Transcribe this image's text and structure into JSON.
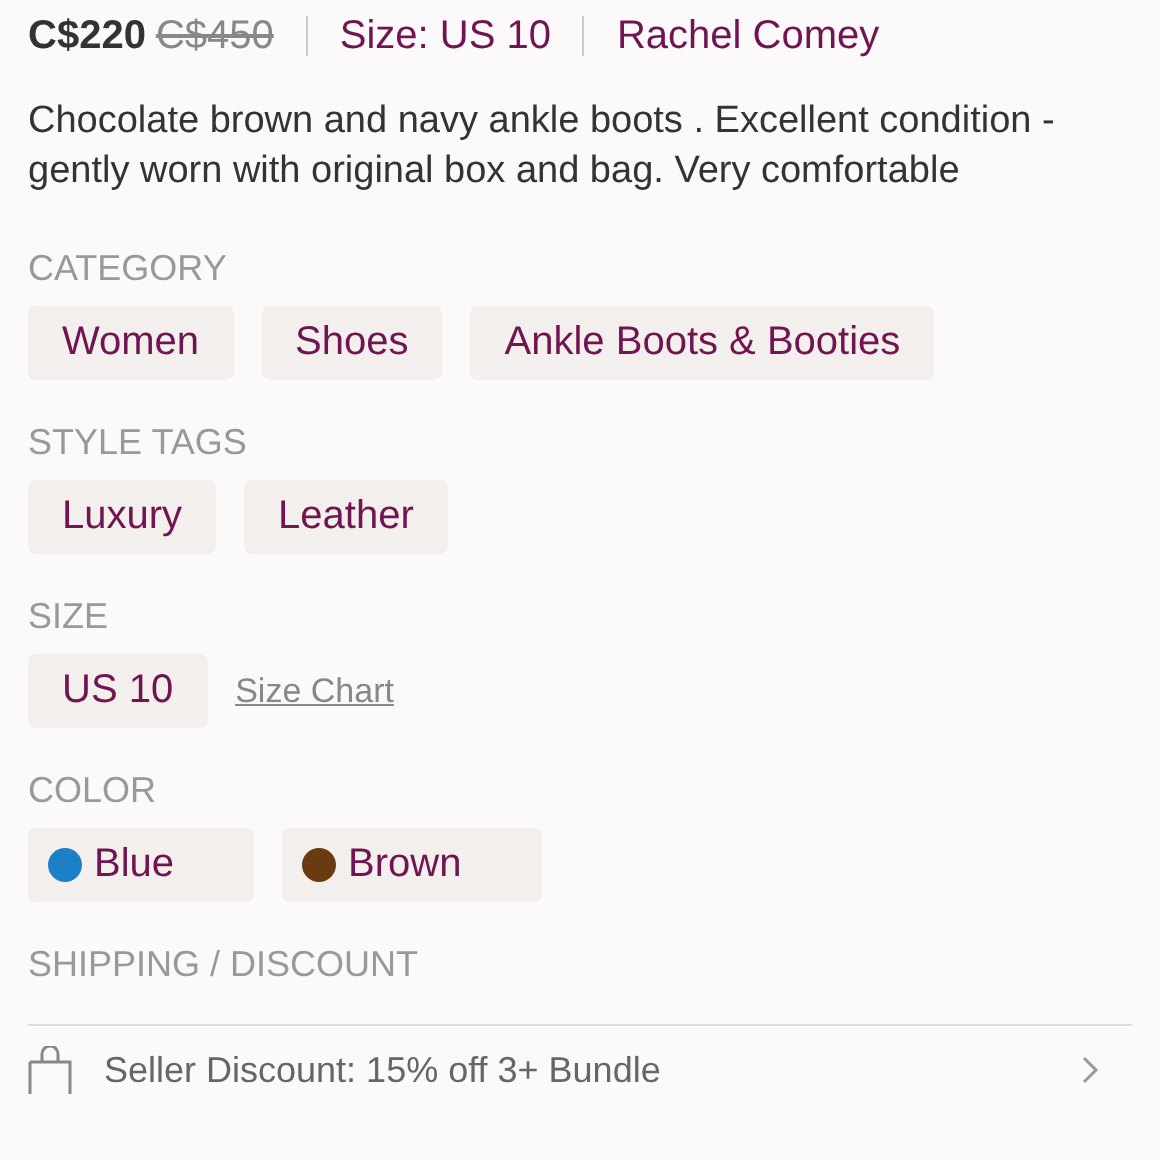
{
  "price": "C$220",
  "original_price": "C$450",
  "size": "Size: US 10",
  "brand": "Rachel Comey",
  "description": "Chocolate brown and navy ankle boots . Excellent condition -gently worn with original box and bag. Very comfortable",
  "sections": [
    {
      "heading": "CATEGORY",
      "kind": "tags",
      "tags": [
        "Women",
        "Shoes",
        "Ankle Boots & Booties"
      ]
    },
    {
      "heading": "STYLE TAGS",
      "kind": "tags",
      "tags": [
        "Luxury",
        "Leather"
      ]
    },
    {
      "heading": "SIZE",
      "kind": "size",
      "tags": [
        "US 10"
      ],
      "link": "Size Chart"
    },
    {
      "heading": "COLOR",
      "kind": "colors",
      "colors": [
        {
          "label": "Blue",
          "color": "#1b80c6"
        },
        {
          "label": "Brown",
          "color": "#6a3a10"
        }
      ]
    },
    {
      "heading": "SHIPPING / DISCOUNT",
      "kind": "rows",
      "rows": [
        {
          "text": "Seller Discount: 15% off 3+ Bundle"
        }
      ]
    }
  ]
}
